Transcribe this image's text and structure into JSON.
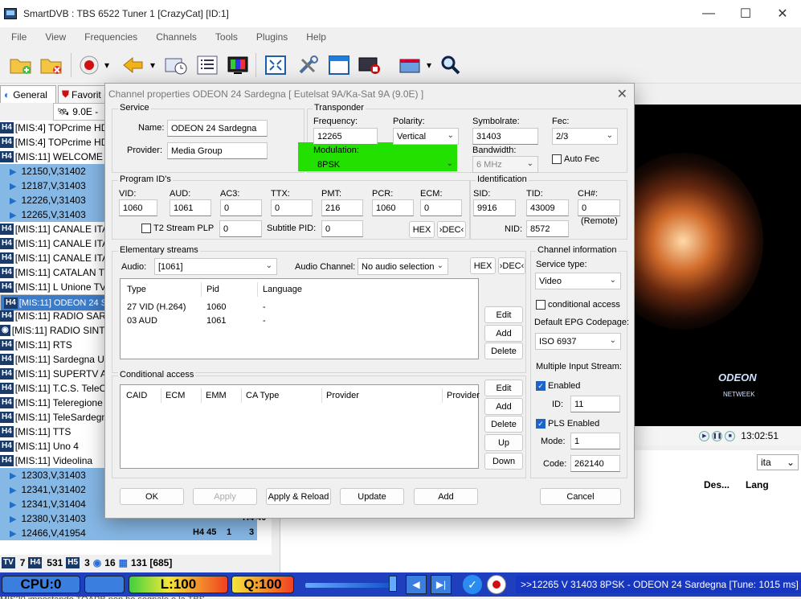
{
  "window": {
    "title": "SmartDVB : TBS 6522 Tuner 1 [CrazyCat] [ID:1]",
    "minimize": "—",
    "maximize": "☐",
    "close": "✕"
  },
  "menu": [
    "File",
    "View",
    "Frequencies",
    "Channels",
    "Tools",
    "Plugins",
    "Help"
  ],
  "toolbar_icons": [
    "open-folder-icon",
    "delete-folder-icon",
    "record-icon",
    "back-arrow-icon",
    "schedule-icon",
    "list-icon",
    "tv-icon",
    "fullscreen-icon",
    "tools-icon",
    "window-icon",
    "stop-recording-icon",
    "epg-icon",
    "search-icon"
  ],
  "left_panel": {
    "tabs": [
      "General",
      "Favorit"
    ],
    "satellite": "9.0E -",
    "channels": [
      {
        "kind": "ch",
        "badge": "H4",
        "label": "[MIS:4] TOPcrime HD"
      },
      {
        "kind": "ch",
        "badge": "H4",
        "label": "[MIS:4] TOPcrime HD"
      },
      {
        "kind": "ch",
        "badge": "H4",
        "label": "[MIS:11] WELCOME IN"
      },
      {
        "kind": "tp",
        "label": "12150,V,31402"
      },
      {
        "kind": "tp",
        "label": "12187,V,31403"
      },
      {
        "kind": "tp",
        "label": "12226,V,31403"
      },
      {
        "kind": "tp",
        "label": "12265,V,31403"
      },
      {
        "kind": "ch",
        "badge": "H4",
        "label": "[MIS:11] CANALE ITAL"
      },
      {
        "kind": "ch",
        "badge": "H4",
        "label": "[MIS:11] CANALE ITAL"
      },
      {
        "kind": "ch",
        "badge": "H4",
        "label": "[MIS:11] CANALE ITAL"
      },
      {
        "kind": "ch",
        "badge": "H4",
        "label": "[MIS:11] CATALAN TV"
      },
      {
        "kind": "ch",
        "badge": "H4",
        "label": "[MIS:11] L Unione TV"
      },
      {
        "kind": "sel",
        "badge": "H4",
        "label": "[MIS:11] ODEON 24 S"
      },
      {
        "kind": "ch",
        "badge": "H4",
        "label": "[MIS:11] RADIO SARD"
      },
      {
        "kind": "ch",
        "badge": "R",
        "label": "[MIS:11] RADIO SINTO"
      },
      {
        "kind": "ch",
        "badge": "H4",
        "label": "[MIS:11] RTS"
      },
      {
        "kind": "ch",
        "badge": "H4",
        "label": "[MIS:11] Sardegna Un"
      },
      {
        "kind": "ch",
        "badge": "H4",
        "label": "[MIS:11] SUPERTV ARI"
      },
      {
        "kind": "ch",
        "badge": "H4",
        "label": "[MIS:11] T.C.S. TeleCo"
      },
      {
        "kind": "ch",
        "badge": "H4",
        "label": "[MIS:11] Teleregione L"
      },
      {
        "kind": "ch",
        "badge": "H4",
        "label": "[MIS:11] TeleSardegna"
      },
      {
        "kind": "ch",
        "badge": "H4",
        "label": "[MIS:11] TTS"
      },
      {
        "kind": "ch",
        "badge": "H4",
        "label": "[MIS:11] Uno 4"
      },
      {
        "kind": "ch",
        "badge": "H4",
        "label": "[MIS:11] Videolina"
      },
      {
        "kind": "tp",
        "label": "12303,V,31403"
      },
      {
        "kind": "tp",
        "label": "12341,V,31402"
      },
      {
        "kind": "tp",
        "label": "12341,V,31404"
      },
      {
        "kind": "tp",
        "label": "12380,V,31403"
      },
      {
        "kind": "tp",
        "label": "12466,V,41954"
      }
    ],
    "row_badges": {
      "r1": "H4 40",
      "r2": "H4 45",
      "r2b": "1",
      "r2c": "3"
    },
    "status": {
      "tv": "7",
      "h4": "531",
      "h5": "3",
      "r": "16",
      "total": "131 [685]"
    }
  },
  "bottom": {
    "cpu": "CPU:0",
    "level": "L:100",
    "quality": "Q:100",
    "ticker": ">>12265 V 31403 8PSK - ODEON 24 Sardegna [Tune: 1015 ms] <<",
    "footer": "MIS20 impostando TOAPB non ho segnale e la TBS"
  },
  "player": {
    "time": "13:02:51",
    "logo": "ODEON",
    "logo_sub": "NETWEEK",
    "lang": "ita",
    "epg_headers": [
      "Des...",
      "Lang"
    ]
  },
  "dialog": {
    "title": "Channel properties ODEON 24 Sardegna [ Eutelsat 9A/Ka-Sat 9A (9.0E) ]",
    "close": "✕",
    "service": {
      "group": "Service",
      "name_label": "Name:",
      "name": "ODEON 24 Sardegna",
      "provider_label": "Provider:",
      "provider": "Media Group"
    },
    "transponder": {
      "group": "Transponder",
      "frequency_label": "Frequency:",
      "frequency": "12265",
      "polarity_label": "Polarity:",
      "polarity": "Vertical",
      "symbolrate_label": "Symbolrate:",
      "symbolrate": "31403",
      "fec_label": "Fec:",
      "fec": "2/3",
      "modulation_label": "Modulation:",
      "modulation": "8PSK",
      "bandwidth_label": "Bandwidth:",
      "bandwidth": "6 MHz",
      "autofec_label": "Auto Fec"
    },
    "pids": {
      "group": "Program ID's",
      "vid_label": "VID:",
      "vid": "1060",
      "aud_label": "AUD:",
      "aud": "1061",
      "ac3_label": "AC3:",
      "ac3": "0",
      "ttx_label": "TTX:",
      "ttx": "0",
      "pmt_label": "PMT:",
      "pmt": "216",
      "pcr_label": "PCR:",
      "pcr": "1060",
      "ecm_label": "ECM:",
      "ecm": "0",
      "t2plp_label": "T2 Stream PLP",
      "t2plp": "0",
      "subtitle_label": "Subtitle PID:",
      "subtitle": "0",
      "hex": "HEX",
      "dec": "›DEC‹"
    },
    "identification": {
      "group": "Identification",
      "sid_label": "SID:",
      "sid": "9916",
      "tid_label": "TID:",
      "tid": "43009",
      "ch_label": "CH#:",
      "ch": "0",
      "remote": "(Remote)",
      "nid_label": "NID:",
      "nid": "8572"
    },
    "streams": {
      "group": "Elementary streams",
      "audio_label": "Audio:",
      "audio": "[1061]",
      "audio_channel_label": "Audio Channel:",
      "audio_channel": "No audio selection",
      "hex": "HEX",
      "dec": "›DEC‹",
      "columns": [
        "Type",
        "Pid",
        "Language"
      ],
      "rows": [
        [
          "27 VID (H.264)",
          "1060",
          "-"
        ],
        [
          "03 AUD",
          "1061",
          "-"
        ]
      ],
      "edit": "Edit",
      "add": "Add",
      "delete": "Delete"
    },
    "ca": {
      "group": "Conditional access",
      "columns": [
        "CAID",
        "ECM",
        "EMM",
        "CA Type",
        "Provider",
        "Provider"
      ],
      "edit": "Edit",
      "add": "Add",
      "delete": "Delete",
      "up": "Up",
      "down": "Down"
    },
    "info": {
      "group": "Channel information",
      "service_type_label": "Service type:",
      "service_type": "Video",
      "cond_access_label": "conditional access",
      "epg_codepage_label": "Default EPG Codepage:",
      "epg_codepage": "ISO 6937",
      "mis_label": "Multiple Input Stream:",
      "enabled_label": "Enabled",
      "id_label": "ID:",
      "id": "11",
      "pls_label": "PLS Enabled",
      "mode_label": "Mode:",
      "mode": "1",
      "code_label": "Code:",
      "code": "262140"
    },
    "buttons": {
      "ok": "OK",
      "apply": "Apply",
      "apply_reload": "Apply & Reload",
      "update": "Update",
      "add": "Add",
      "cancel": "Cancel"
    }
  }
}
